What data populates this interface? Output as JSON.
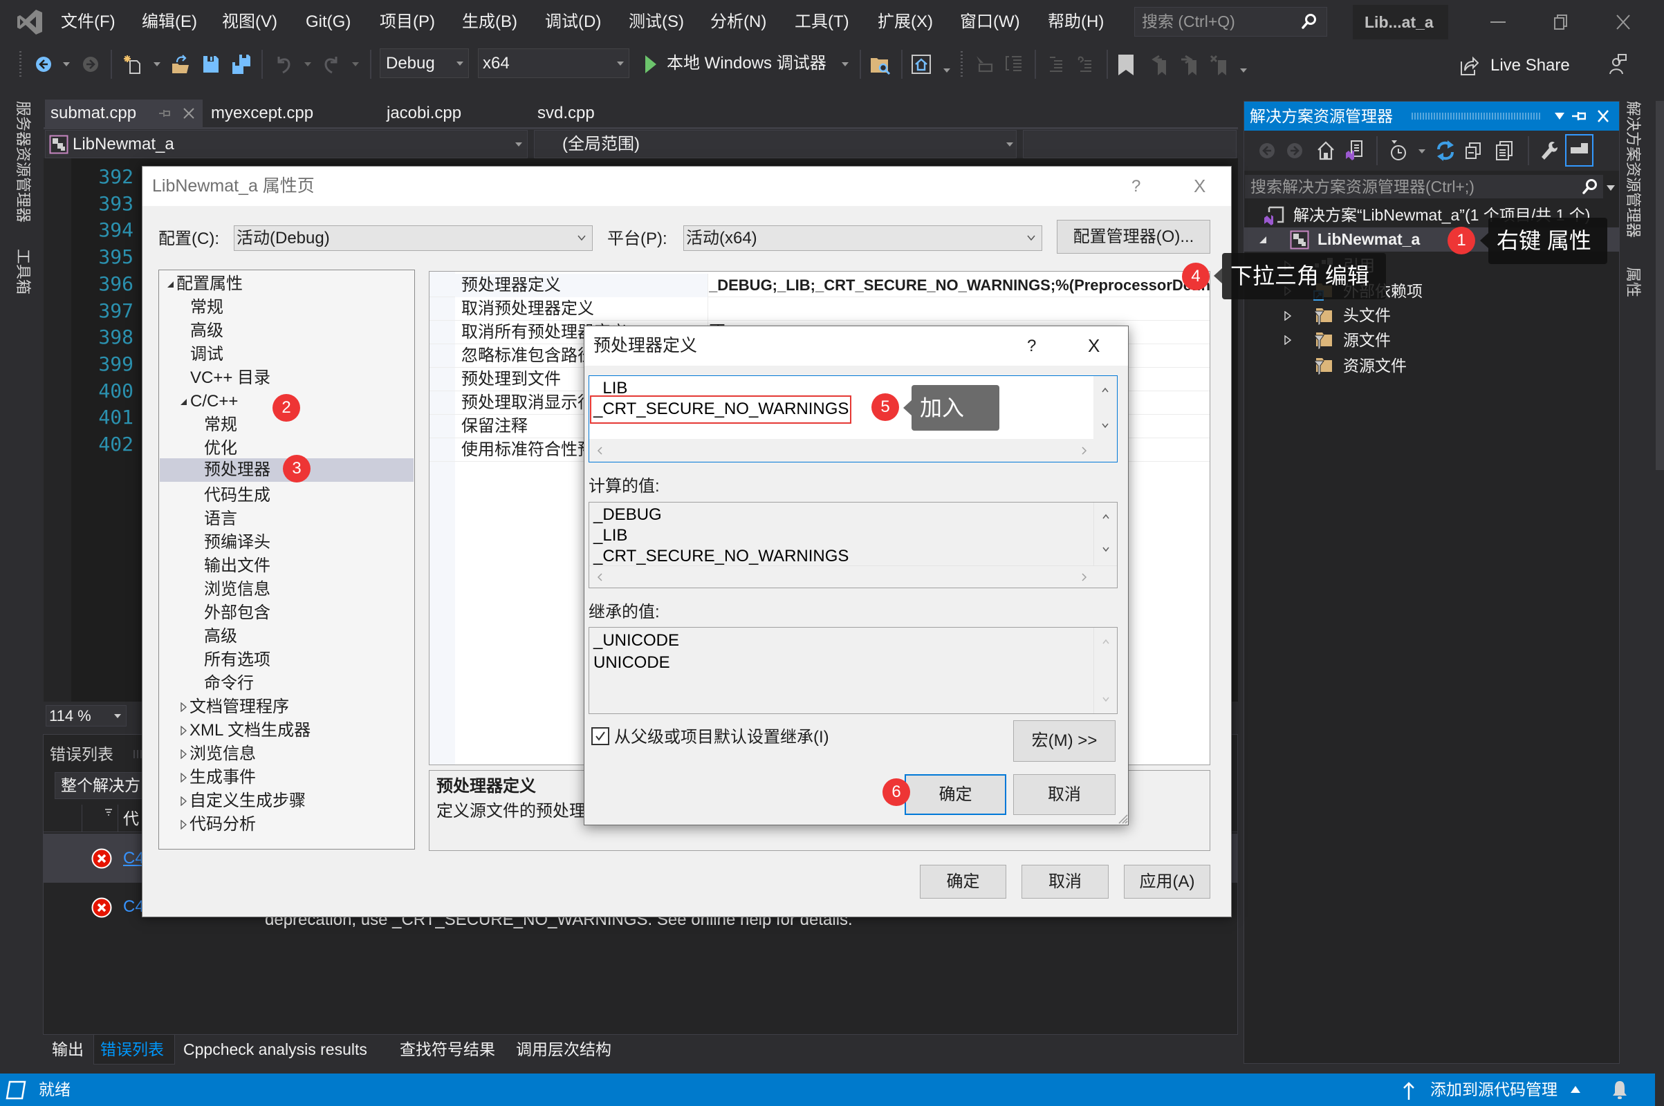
{
  "app": {
    "title": "Lib...at_a",
    "menu": [
      "文件(F)",
      "编辑(E)",
      "视图(V)",
      "Git(G)",
      "项目(P)",
      "生成(B)",
      "调试(D)",
      "测试(S)",
      "分析(N)",
      "工具(T)",
      "扩展(X)",
      "窗口(W)",
      "帮助(H)"
    ],
    "search_placeholder": "搜索 (Ctrl+Q)"
  },
  "toolbar": {
    "configuration": "Debug",
    "platform": "x64",
    "start_debugger": "本地 Windows 调试器",
    "live_share": "Live Share"
  },
  "side_tabs": {
    "left": [
      "服务器资源管理器",
      "工具箱"
    ],
    "right": [
      "解决方案资源管理器",
      "属性"
    ]
  },
  "editor": {
    "tabs": [
      {
        "label": "submat.cpp",
        "active": true
      },
      {
        "label": "myexcept.cpp",
        "active": false
      },
      {
        "label": "jacobi.cpp",
        "active": false
      },
      {
        "label": "svd.cpp",
        "active": false
      }
    ],
    "nav_project": "LibNewmat_a",
    "nav_scope": "(全局范围)",
    "line_numbers": [
      "392",
      "393",
      "394",
      "395",
      "396",
      "397",
      "398",
      "399",
      "400",
      "401",
      "402"
    ],
    "zoom": "114 %"
  },
  "error_list": {
    "title": "错误列表",
    "scope": "整个解决方",
    "code_column": "代",
    "rows": [
      {
        "severity": "error",
        "code": "C4",
        "selected": true
      },
      {
        "severity": "error",
        "code": "C4",
        "selected": false
      }
    ],
    "message_fragment": "deprecation, use _CRT_SECURE_NO_WARNINGS. See online help for details."
  },
  "bottom_tabs": {
    "items": [
      "输出",
      "错误列表",
      "Cppcheck analysis results",
      "查找符号结果",
      "调用层次结构"
    ],
    "active": "错误列表"
  },
  "status_bar": {
    "state": "就绪",
    "source_control": "添加到源代码管理"
  },
  "solution_explorer": {
    "title": "解决方案资源管理器",
    "search_placeholder": "搜索解决方案资源管理器(Ctrl+;)",
    "solution": "解决方案“LibNewmat_a”(1 个项目/共 1 个)",
    "project": "LibNewmat_a",
    "nodes": [
      {
        "label": "引用",
        "expandable": true
      },
      {
        "label": "外部依赖项",
        "expandable": true
      },
      {
        "label": "头文件",
        "expandable": true
      },
      {
        "label": "源文件",
        "expandable": true
      },
      {
        "label": "资源文件",
        "expandable": false
      }
    ]
  },
  "property_pages": {
    "title": "LibNewmat_a 属性页",
    "help": "?",
    "close": "X",
    "config_label": "配置(C):",
    "config_value": "活动(Debug)",
    "platform_label": "平台(P):",
    "platform_value": "活动(x64)",
    "config_manager": "配置管理器(O)...",
    "tree": [
      {
        "label": "配置属性",
        "level": 0,
        "expanded": true
      },
      {
        "label": "常规",
        "level": 1
      },
      {
        "label": "高级",
        "level": 1
      },
      {
        "label": "调试",
        "level": 1
      },
      {
        "label": "VC++ 目录",
        "level": 1
      },
      {
        "label": "C/C++",
        "level": 1,
        "expanded": true
      },
      {
        "label": "常规",
        "level": 2
      },
      {
        "label": "优化",
        "level": 2
      },
      {
        "label": "预处理器",
        "level": 2,
        "selected": true
      },
      {
        "label": "代码生成",
        "level": 2
      },
      {
        "label": "语言",
        "level": 2
      },
      {
        "label": "预编译头",
        "level": 2
      },
      {
        "label": "输出文件",
        "level": 2
      },
      {
        "label": "浏览信息",
        "level": 2
      },
      {
        "label": "外部包含",
        "level": 2
      },
      {
        "label": "高级",
        "level": 2
      },
      {
        "label": "所有选项",
        "level": 2
      },
      {
        "label": "命令行",
        "level": 2
      },
      {
        "label": "文档管理程序",
        "level": 1,
        "expanded": false
      },
      {
        "label": "XML 文档生成器",
        "level": 1,
        "expanded": false
      },
      {
        "label": "浏览信息",
        "level": 1,
        "expanded": false
      },
      {
        "label": "生成事件",
        "level": 1,
        "expanded": false
      },
      {
        "label": "自定义生成步骤",
        "level": 1,
        "expanded": false
      },
      {
        "label": "代码分析",
        "level": 1,
        "expanded": false
      }
    ],
    "grid": [
      {
        "name": "预处理器定义",
        "value": "_DEBUG;_LIB;_CRT_SECURE_NO_WARNINGS;%(PreprocessorDefinitions)"
      },
      {
        "name": "取消预处理器定义",
        "value": ""
      },
      {
        "name": "取消所有预处理器定义",
        "value": "否"
      },
      {
        "name": "忽略标准包含路径",
        "value": ""
      },
      {
        "name": "预处理到文件",
        "value": ""
      },
      {
        "name": "预处理取消显示行号",
        "value": ""
      },
      {
        "name": "保留注释",
        "value": ""
      },
      {
        "name": "使用标准符合性预处理器",
        "value": ""
      }
    ],
    "description_title": "预处理器定义",
    "description_text": "定义源文件的预处理",
    "ok": "确定",
    "cancel": "取消",
    "apply": "应用(A)"
  },
  "preprocessor_dialog": {
    "title": "预处理器定义",
    "help": "?",
    "close": "X",
    "definitions": [
      "_LIB",
      "_CRT_SECURE_NO_WARNINGS"
    ],
    "computed_label": "计算的值:",
    "computed": [
      "_DEBUG",
      "_LIB",
      "_CRT_SECURE_NO_WARNINGS"
    ],
    "inherited_label": "继承的值:",
    "inherited": [
      "_UNICODE",
      "UNICODE"
    ],
    "inherit_checkbox": {
      "label": "从父级或项目默认设置继承(I)",
      "checked": true
    },
    "macros": "宏(M) >>",
    "ok": "确定",
    "cancel": "取消"
  },
  "annotations": [
    {
      "number": "1",
      "note": "右键 属性"
    },
    {
      "number": "2"
    },
    {
      "number": "3"
    },
    {
      "number": "4",
      "note": "下拉三角 编辑"
    },
    {
      "number": "5",
      "note": "加入"
    },
    {
      "number": "6"
    }
  ],
  "colors": {
    "accent": "#007acc",
    "badge": "#ee3535",
    "line_number": "#2b91af",
    "highlight_box": "#e53935",
    "error": "#e51400",
    "link": "#3794ff"
  }
}
